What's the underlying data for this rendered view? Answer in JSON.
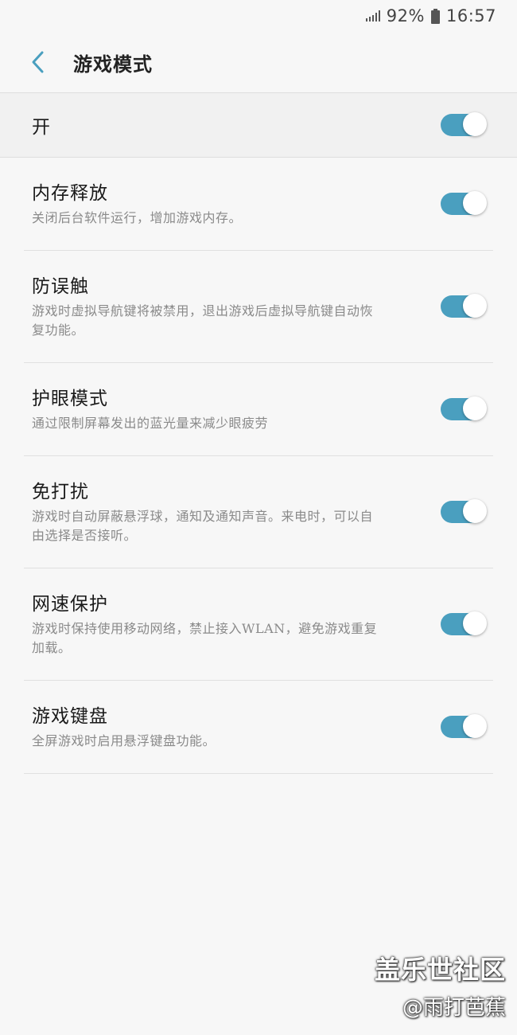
{
  "status_bar": {
    "battery": "92%",
    "time": "16:57",
    "icons": [
      "signal-icon",
      "battery-icon"
    ]
  },
  "header": {
    "back_icon": "chevron-left-icon",
    "title": "游戏模式"
  },
  "master": {
    "label": "开",
    "on": true
  },
  "settings": [
    {
      "title": "内存释放",
      "description": "关闭后台软件运行，增加游戏内存。",
      "on": true
    },
    {
      "title": "防误触",
      "description": "游戏时虚拟导航键将被禁用，退出游戏后虚拟导航键自动恢复功能。",
      "on": true
    },
    {
      "title": "护眼模式",
      "description": "通过限制屏幕发出的蓝光量来减少眼疲劳",
      "on": true
    },
    {
      "title": "免打扰",
      "description": "游戏时自动屏蔽悬浮球，通知及通知声音。来电时，可以自由选择是否接听。",
      "on": true
    },
    {
      "title": "网速保护",
      "description": "游戏时保持使用移动网络，禁止接入WLAN，避免游戏重复加载。",
      "on": true
    },
    {
      "title": "游戏键盘",
      "description": "全屏游戏时启用悬浮键盘功能。",
      "on": true
    }
  ],
  "colors": {
    "accent": "#4a9fbf",
    "background": "#f7f7f7",
    "divider": "#e0e0e0"
  },
  "watermark": {
    "brand": "盖乐世社区",
    "author": "@雨打芭蕉"
  }
}
